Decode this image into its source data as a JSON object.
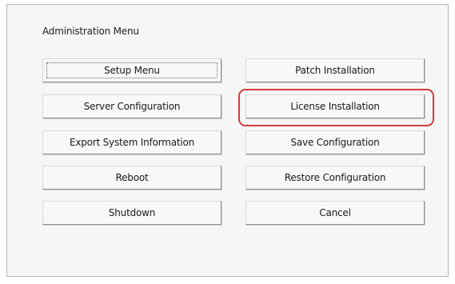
{
  "menu": {
    "title": "Administration Menu",
    "left_buttons": [
      {
        "label": "Setup Menu"
      },
      {
        "label": "Server Configuration"
      },
      {
        "label": "Export System Information"
      },
      {
        "label": "Reboot"
      },
      {
        "label": "Shutdown"
      }
    ],
    "right_buttons": [
      {
        "label": "Patch Installation"
      },
      {
        "label": "License Installation"
      },
      {
        "label": "Save Configuration"
      },
      {
        "label": "Restore Configuration"
      },
      {
        "label": "Cancel"
      }
    ]
  },
  "annotation": {
    "highlight_color": "#d23c3c",
    "highlighted_button": "License Installation"
  }
}
